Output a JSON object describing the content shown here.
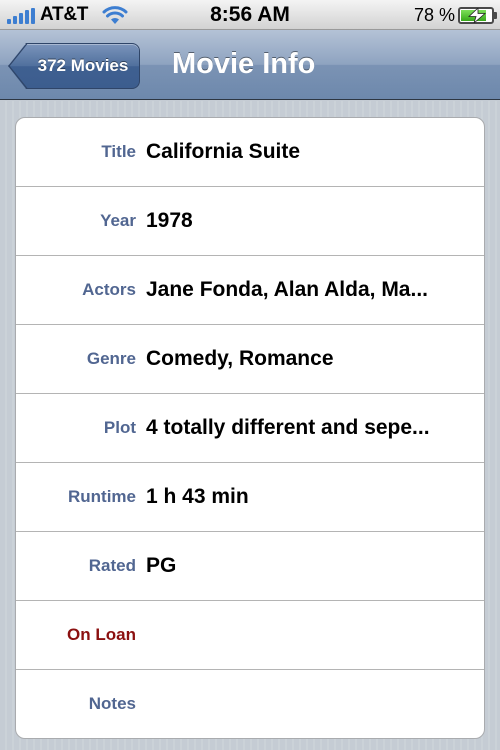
{
  "status_bar": {
    "carrier": "AT&T",
    "time": "8:56 AM",
    "battery_percent": "78 %",
    "battery_level": 0.78,
    "icons": [
      "signal-icon",
      "wifi-icon",
      "battery-charging-icon"
    ]
  },
  "nav": {
    "back_label": "372 Movies",
    "title": "Movie Info"
  },
  "fields": [
    {
      "label": "Title",
      "value": "California Suite"
    },
    {
      "label": "Year",
      "value": "1978"
    },
    {
      "label": "Actors",
      "value": "Jane Fonda, Alan Alda, Ma..."
    },
    {
      "label": "Genre",
      "value": "Comedy, Romance"
    },
    {
      "label": "Plot",
      "value": "4 totally different and sepe..."
    },
    {
      "label": "Runtime",
      "value": "1 h 43 min"
    },
    {
      "label": "Rated",
      "value": "PG"
    },
    {
      "label": "On Loan",
      "value": ""
    },
    {
      "label": "Notes",
      "value": ""
    }
  ],
  "colors": {
    "field_label": "#516691",
    "on_loan_label": "#8b1010",
    "nav_bar": "#7b93b4",
    "background": "#c5ccd4"
  }
}
